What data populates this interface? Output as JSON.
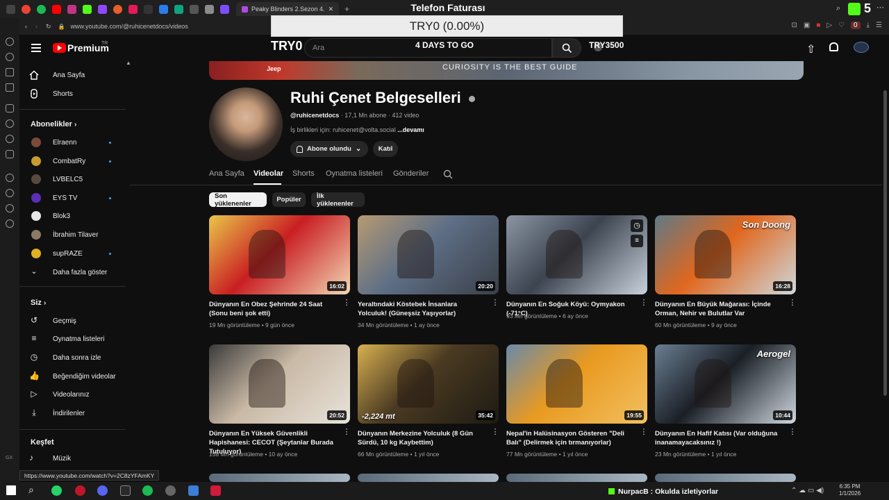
{
  "browser": {
    "active_tab_title": "Peaky Blinders 2.Sezon 4.",
    "url": "www.youtube.com/@ruhicenetdocs/videos",
    "status_url": "https://www.youtube.com/watch?v=2C8zYFAmKY",
    "zero_badge": "0"
  },
  "overlay": {
    "title": "Telefon Faturası",
    "amount": "TRY0 (0.00%)",
    "left_label": "TRY0",
    "countdown": "4 DAYS TO GO",
    "target": "TRY3500"
  },
  "header": {
    "logo_text": "Premium",
    "logo_sup": "TR",
    "search_placeholder": "Ara"
  },
  "sidebar": {
    "top": [
      {
        "label": "Ana Sayfa",
        "icon": "home-icon"
      },
      {
        "label": "Shorts",
        "icon": "shorts-icon"
      }
    ],
    "subs_header": "Abonelikler",
    "subs": [
      {
        "label": "Elraenn",
        "dot": true,
        "color": "#7a4b3a"
      },
      {
        "label": "CombatRy",
        "dot": true,
        "color": "#c79b2d"
      },
      {
        "label": "LVBELC5",
        "dot": false,
        "color": "#5a4a3e"
      },
      {
        "label": "EYS TV",
        "dot": true,
        "color": "#5b2fb5"
      },
      {
        "label": "Blok3",
        "dot": false,
        "color": "#e8e8e8"
      },
      {
        "label": "İbrahim Tilaver",
        "dot": false,
        "color": "#8a7a66"
      },
      {
        "label": "supRAZE",
        "dot": true,
        "color": "#e0b020"
      }
    ],
    "show_more": "Daha fazla göster",
    "you_header": "Siz",
    "you": [
      {
        "label": "Geçmiş",
        "icon": "history-icon"
      },
      {
        "label": "Oynatma listeleri",
        "icon": "playlist-icon"
      },
      {
        "label": "Daha sonra izle",
        "icon": "clock-icon"
      },
      {
        "label": "Beğendiğim videolar",
        "icon": "thumbs-up-icon"
      },
      {
        "label": "Videolarınız",
        "icon": "your-videos-icon"
      },
      {
        "label": "İndirilenler",
        "icon": "download-icon"
      }
    ],
    "explore_header": "Keşfet",
    "explore": [
      {
        "label": "Müzik",
        "icon": "music-icon"
      }
    ]
  },
  "channel": {
    "banner_text": "CURIOSITY IS THE BEST GUIDE",
    "banner_brand": "Jeep",
    "name": "Ruhi Çenet Belgeselleri",
    "handle": "@ruhicenetdocs",
    "stats": "· 17,1 Mn abone · 412 video",
    "contact": "İş birlikleri için: ruhicenet@volta.social",
    "more": "...devamı",
    "subscribed_label": "Abone olundu",
    "join_label": "Katıl",
    "tabs": [
      "Ana Sayfa",
      "Videolar",
      "Shorts",
      "Oynatma listeleri",
      "Gönderiler"
    ],
    "chips": [
      "Son yüklenenler",
      "Popüler",
      "İlk yüklenenler"
    ]
  },
  "videos": [
    {
      "title": "Dünyanın En Obez Şehrinde 24 Saat (Sonu beni şok etti)",
      "views": "19 Mn görüntüleme",
      "age": "9 gün önce",
      "duration": "16:02",
      "palette": [
        "#c91e22",
        "#e9c64a",
        "#f2d7b4"
      ]
    },
    {
      "title": "Yeraltındaki Köstebek İnsanlara Yolculuk! (Güneşsiz Yaşıyorlar)",
      "views": "34 Mn görüntüleme",
      "age": "1 ay önce",
      "duration": "20:20",
      "palette": [
        "#5e6f86",
        "#b69a72",
        "#3a3f48"
      ]
    },
    {
      "title": "Dünyanın En Soğuk Köyü: Oymyakon (-71°C)",
      "views": "93 Mn görüntüleme",
      "age": "6 ay önce",
      "duration": "",
      "palette": [
        "#3c4450",
        "#8c95a3",
        "#c9d2dc"
      ]
    },
    {
      "title": "Dünyanın En Büyük Mağarası: İçinde Orman, Nehir ve Bulutlar Var",
      "views": "60 Mn görüntüleme",
      "age": "9 ay önce",
      "duration": "16:28",
      "palette": [
        "#e0671e",
        "#5f7a86",
        "#cfd8dc"
      ],
      "overlay_text": "Son Doong"
    },
    {
      "title": "Dünyanın En Yüksek Güvenlikli Hapishanesi: CECOT (Şeytanlar Burada Tutuluyor)",
      "views": "158 Mn görüntüleme",
      "age": "10 ay önce",
      "duration": "20:52",
      "palette": [
        "#c9b9a5",
        "#3b3b3b",
        "#e8e3db"
      ]
    },
    {
      "title": "Dünyanın Merkezine Yolculuk (8 Gün Sürdü, 10 kg Kaybettim)",
      "views": "66 Mn görüntüleme",
      "age": "1 yıl önce",
      "duration": "35:42",
      "palette": [
        "#4a3a22",
        "#d8b050",
        "#1e1a12"
      ],
      "overlay_text": "-2,224 mt"
    },
    {
      "title": "Nepal'in Halüsinasyon Gösteren \"Deli Balı\" (Delirmek için tırmanıyorlar)",
      "views": "77 Mn görüntüleme",
      "age": "1 yıl önce",
      "duration": "19:55",
      "palette": [
        "#e89a20",
        "#6a8aa8",
        "#f2c060"
      ]
    },
    {
      "title": "Dünyanın En Hafif Katısı (Var olduğuna inanamayacaksınız !)",
      "views": "23 Mn görüntüleme",
      "age": "1 yıl önce",
      "duration": "10:44",
      "palette": [
        "#1a1f26",
        "#6b7e92",
        "#d0d8e0"
      ],
      "overlay_text": "Aerogel"
    }
  ],
  "taskbar": {
    "notification": "NurpacB : Okulda izletiyorlar",
    "time": "6:35 PM",
    "date": "1/1/2026"
  },
  "extension": {
    "counter": "5"
  },
  "colors": {
    "accent": "#3ea6ff",
    "youtube_red": "#ff0000",
    "chip_active_bg": "#f1f1f1",
    "chip_bg": "#272727"
  }
}
